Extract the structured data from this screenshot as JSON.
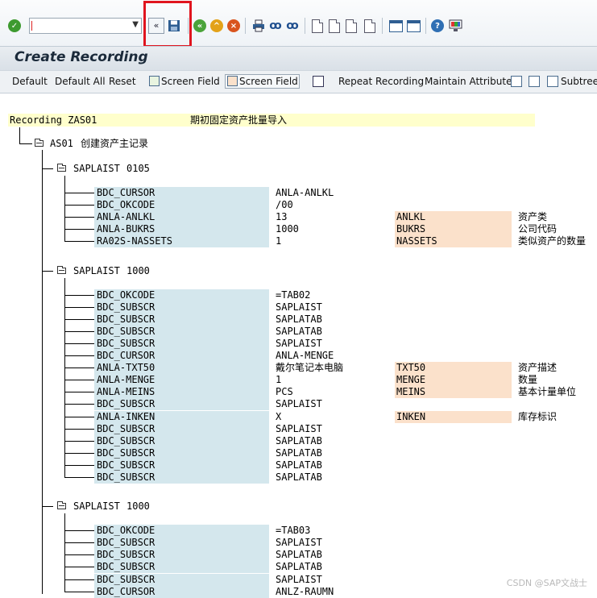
{
  "toolbar": {
    "command_field_value": "",
    "collapse_glyph": "«",
    "icons": [
      "enter-icon",
      "command-field",
      "collapse-icon",
      "save-icon",
      "back-icon",
      "exit-icon",
      "cancel-icon",
      "print-icon",
      "find-icon",
      "find-next-icon",
      "first-page-icon",
      "previous-page-icon",
      "next-page-icon",
      "last-page-icon",
      "create-session-icon",
      "shortcut-icon",
      "help-icon",
      "customize-layout-icon"
    ]
  },
  "title": "Create Recording",
  "app_toolbar": {
    "default": "Default",
    "default_all": "Default All",
    "reset": "Reset",
    "screen_field_1": "Screen Field",
    "screen_field_2": "Screen Field",
    "repeat_recording": "Repeat Recording",
    "maintain_attributes": "Maintain Attributes",
    "subtree": "Subtree"
  },
  "recording": {
    "label": "Recording ZAS01",
    "description": "期初固定资产批量导入",
    "transaction": "AS01",
    "transaction_desc": "创建资产主记录",
    "screens": [
      {
        "program": "SAPLAIST",
        "number": "0105",
        "rows": [
          {
            "field": "BDC_CURSOR",
            "value": "ANLA-ANLKL",
            "screen_field": "",
            "desc": ""
          },
          {
            "field": "BDC_OKCODE",
            "value": "/00",
            "screen_field": "",
            "desc": ""
          },
          {
            "field": "ANLA-ANLKL",
            "value": "13",
            "screen_field": "ANLKL",
            "desc": "资产类"
          },
          {
            "field": "ANLA-BUKRS",
            "value": "1000",
            "screen_field": "BUKRS",
            "desc": "公司代码"
          },
          {
            "field": "RA02S-NASSETS",
            "value": "1",
            "screen_field": "NASSETS",
            "desc": "类似资产的数量"
          }
        ]
      },
      {
        "program": "SAPLAIST",
        "number": "1000",
        "rows": [
          {
            "field": "BDC_OKCODE",
            "value": "=TAB02",
            "screen_field": "",
            "desc": ""
          },
          {
            "field": "BDC_SUBSCR",
            "value": "SAPLAIST",
            "screen_field": "",
            "desc": ""
          },
          {
            "field": "BDC_SUBSCR",
            "value": "SAPLATAB",
            "screen_field": "",
            "desc": ""
          },
          {
            "field": "BDC_SUBSCR",
            "value": "SAPLATAB",
            "screen_field": "",
            "desc": ""
          },
          {
            "field": "BDC_SUBSCR",
            "value": "SAPLAIST",
            "screen_field": "",
            "desc": ""
          },
          {
            "field": "BDC_CURSOR",
            "value": "ANLA-MENGE",
            "screen_field": "",
            "desc": ""
          },
          {
            "field": "ANLA-TXT50",
            "value": "戴尔笔记本电脑",
            "screen_field": "TXT50",
            "desc": "资产描述"
          },
          {
            "field": "ANLA-MENGE",
            "value": "1",
            "screen_field": "MENGE",
            "desc": "数量"
          },
          {
            "field": "ANLA-MEINS",
            "value": "PCS",
            "screen_field": "MEINS",
            "desc": "基本计量单位"
          },
          {
            "field": "BDC_SUBSCR",
            "value": "SAPLAIST",
            "screen_field": "",
            "desc": ""
          },
          {
            "field": "ANLA-INKEN",
            "value": "X",
            "screen_field": "INKEN",
            "desc": "库存标识"
          },
          {
            "field": "BDC_SUBSCR",
            "value": "SAPLAIST",
            "screen_field": "",
            "desc": ""
          },
          {
            "field": "BDC_SUBSCR",
            "value": "SAPLATAB",
            "screen_field": "",
            "desc": ""
          },
          {
            "field": "BDC_SUBSCR",
            "value": "SAPLATAB",
            "screen_field": "",
            "desc": ""
          },
          {
            "field": "BDC_SUBSCR",
            "value": "SAPLATAB",
            "screen_field": "",
            "desc": ""
          },
          {
            "field": "BDC_SUBSCR",
            "value": "SAPLATAB",
            "screen_field": "",
            "desc": ""
          }
        ]
      },
      {
        "program": "SAPLAIST",
        "number": "1000",
        "rows": [
          {
            "field": "BDC_OKCODE",
            "value": "=TAB03",
            "screen_field": "",
            "desc": ""
          },
          {
            "field": "BDC_SUBSCR",
            "value": "SAPLAIST",
            "screen_field": "",
            "desc": ""
          },
          {
            "field": "BDC_SUBSCR",
            "value": "SAPLATAB",
            "screen_field": "",
            "desc": ""
          },
          {
            "field": "BDC_SUBSCR",
            "value": "SAPLATAB",
            "screen_field": "",
            "desc": ""
          },
          {
            "field": "BDC_SUBSCR",
            "value": "SAPLAIST",
            "screen_field": "",
            "desc": ""
          },
          {
            "field": "BDC_CURSOR",
            "value": "ANLZ-RAUMN",
            "screen_field": "",
            "desc": ""
          }
        ]
      }
    ]
  },
  "watermark": "CSDN @SAP文战士"
}
